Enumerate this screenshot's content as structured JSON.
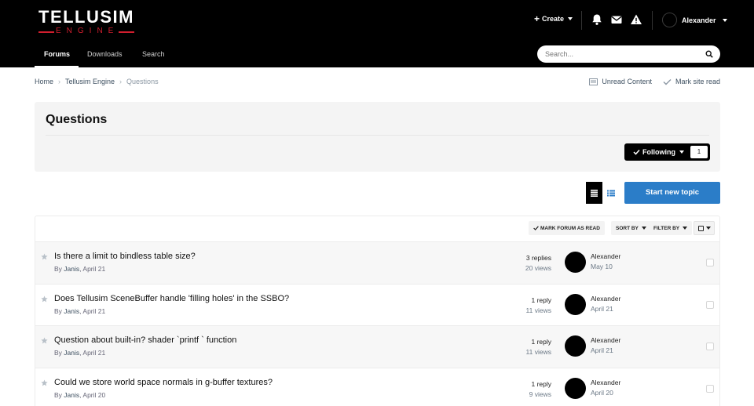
{
  "header": {
    "logo_main": "TELLUSIM",
    "logo_sub": "ENGINE",
    "create_label": "Create",
    "user_name": "Alexander",
    "nav": [
      {
        "label": "Forums"
      },
      {
        "label": "Downloads"
      },
      {
        "label": "Search"
      }
    ],
    "search_placeholder": "Search..."
  },
  "breadcrumb": {
    "items": [
      "Home",
      "Tellusim Engine",
      "Questions"
    ]
  },
  "site_links": {
    "unread": "Unread Content",
    "mark_read": "Mark site read"
  },
  "page": {
    "title": "Questions",
    "following_label": "Following",
    "following_count": "1",
    "start_topic_label": "Start new topic"
  },
  "toolbar": {
    "mark_forum_read": "MARK FORUM AS READ",
    "sort_by": "SORT BY",
    "filter_by": "FILTER BY"
  },
  "topics": [
    {
      "title": "Is there a limit to bindless table size?",
      "by": "By",
      "author": "Janis",
      "date": "April 21",
      "replies": "3 replies",
      "views": "20 views",
      "last_user": "Alexander",
      "last_date": "May 10"
    },
    {
      "title": "Does Tellusim SceneBuffer handle 'filling holes' in the SSBO?",
      "by": "By",
      "author": "Janis",
      "date": "April 21",
      "replies": "1 reply",
      "views": "11 views",
      "last_user": "Alexander",
      "last_date": "April 21"
    },
    {
      "title": "Question about built-in? shader `printf ` function",
      "by": "By",
      "author": "Janis",
      "date": "April 21",
      "replies": "1 reply",
      "views": "11 views",
      "last_user": "Alexander",
      "last_date": "April 21"
    },
    {
      "title": "Could we store world space normals in g-buffer textures?",
      "by": "By",
      "author": "Janis",
      "date": "April 20",
      "replies": "1 reply",
      "views": "9 views",
      "last_user": "Alexander",
      "last_date": "April 20"
    }
  ],
  "colors": {
    "header_bg": "#000000",
    "brand_red": "#d11e2e",
    "accent_blue": "#2b7dc8"
  }
}
